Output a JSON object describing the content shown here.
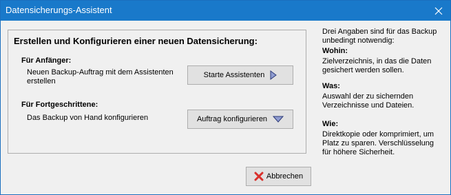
{
  "window": {
    "title": "Datensicherungs-Assistent"
  },
  "panel": {
    "heading": "Erstellen und Konfigurieren einer neuen Datensicherung:",
    "beginner": {
      "label": "Für Anfänger:",
      "description_line1": "Neuen Backup-Auftrag mit dem Assistenten",
      "description_line2": "erstellen",
      "button_label": "Starte Assistenten",
      "button_icon": "play-triangle-icon"
    },
    "advanced": {
      "label": "Für Fortgeschrittene:",
      "description": "Das Backup von Hand konfigurieren",
      "button_label": "Auftrag konfigurieren",
      "button_icon": "dropdown-triangle-icon"
    }
  },
  "info": {
    "intro_line1": "Drei Angaben sind für das Backup",
    "intro_line2": "unbedingt notwendig:",
    "wohin_title": "Wohin:",
    "wohin_line1": "Zielverzeichnis, in das die Daten",
    "wohin_line2": "gesichert werden sollen.",
    "was_title": "Was:",
    "was_line1": "Auswahl der zu sichernden",
    "was_line2": "Verzeichnisse und Dateien.",
    "wie_title": "Wie:",
    "wie_line1": "Direktkopie oder komprimiert, um",
    "wie_line2": "Platz zu sparen. Verschlüsselung",
    "wie_line3": "für höhere Sicherheit."
  },
  "footer": {
    "cancel_label": "Abbrechen",
    "cancel_icon": "red-x-icon"
  },
  "colors": {
    "titlebar": "#1979ca",
    "button_icon_fill": "#3b4a8a",
    "cancel_icon": "#d9302c"
  }
}
